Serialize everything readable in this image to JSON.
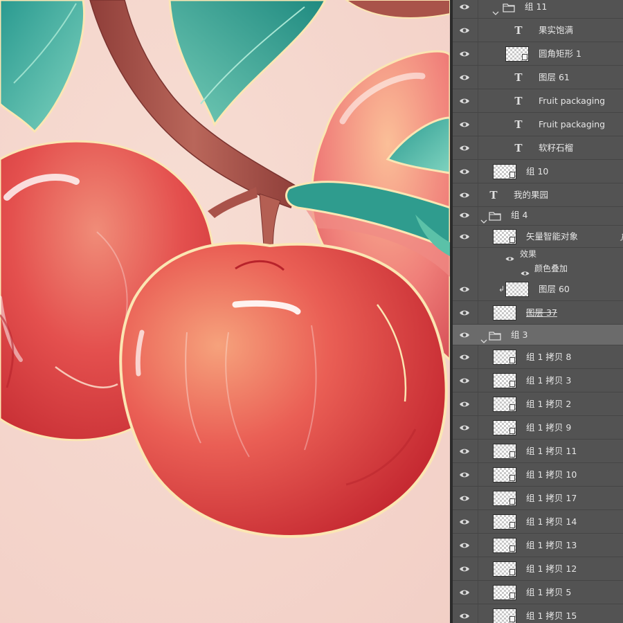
{
  "layers_panel": {
    "layers": [
      {
        "name": "组 11",
        "kind": "group",
        "expanded": true,
        "visible": true
      },
      {
        "name": "果实饱满",
        "kind": "text",
        "visible": true
      },
      {
        "name": "圆角矩形 1",
        "kind": "shape",
        "visible": true
      },
      {
        "name": "图层 61",
        "kind": "text",
        "visible": true
      },
      {
        "name": "Fruit packaging",
        "kind": "text",
        "visible": true
      },
      {
        "name": "Fruit packaging",
        "kind": "text",
        "visible": true
      },
      {
        "name": "软籽石榴",
        "kind": "text",
        "visible": true
      },
      {
        "name": "组 10",
        "kind": "smart",
        "visible": true
      },
      {
        "name": "我的果园",
        "kind": "text",
        "visible": true
      },
      {
        "name": "组 4",
        "kind": "group",
        "expanded": true,
        "visible": true
      },
      {
        "name": "矢量智能对象",
        "kind": "smart",
        "visible": true,
        "has_effects": true
      },
      {
        "name": "效果",
        "kind": "effects-header",
        "visible": true
      },
      {
        "name": "颜色叠加",
        "kind": "effect",
        "visible": true
      },
      {
        "name": "图层 60",
        "kind": "clipped-layer",
        "visible": true
      },
      {
        "name": "图层 37",
        "kind": "layer",
        "visible": true
      },
      {
        "name": "组 3",
        "kind": "group",
        "expanded": true,
        "visible": true,
        "selected": true
      },
      {
        "name": "组 1 拷贝 8",
        "kind": "smart",
        "visible": true
      },
      {
        "name": "组 1 拷贝 3",
        "kind": "smart",
        "visible": true
      },
      {
        "name": "组 1 拷贝 2",
        "kind": "smart",
        "visible": true
      },
      {
        "name": "组 1 拷贝 9",
        "kind": "smart",
        "visible": true
      },
      {
        "name": "组 1 拷贝 11",
        "kind": "smart",
        "visible": true
      },
      {
        "name": "组 1 拷贝 10",
        "kind": "smart",
        "visible": true
      },
      {
        "name": "组 1 拷贝 17",
        "kind": "smart",
        "visible": true
      },
      {
        "name": "组 1 拷贝 14",
        "kind": "smart",
        "visible": true
      },
      {
        "name": "组 1 拷贝 13",
        "kind": "smart",
        "visible": true
      },
      {
        "name": "组 1 拷贝 12",
        "kind": "smart",
        "visible": true
      },
      {
        "name": "组 1 拷贝 5",
        "kind": "smart",
        "visible": true
      },
      {
        "name": "组 1 拷贝 15",
        "kind": "smart",
        "visible": true
      }
    ]
  },
  "colors": {
    "panel_bg": "#535353",
    "selected_row": "#6b6b6b",
    "canvas_bg": "#f6d9d0",
    "apple_red": "#d83a3c",
    "leaf_teal": "#2f9c8e",
    "stem_brown": "#a9534a"
  }
}
